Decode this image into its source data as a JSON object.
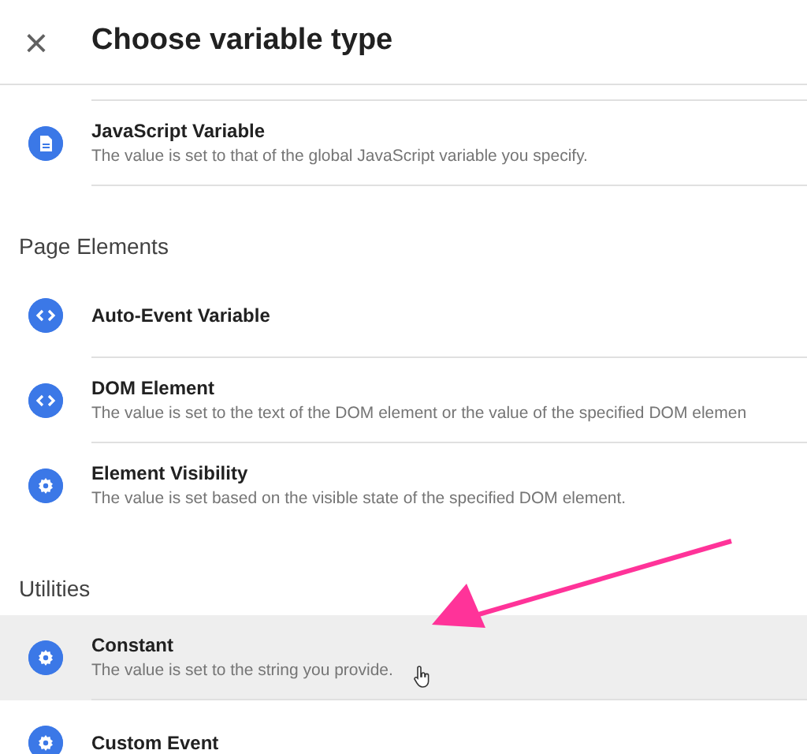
{
  "header": {
    "close": "×",
    "title": "Choose variable type"
  },
  "sections": [
    {
      "items": [
        {
          "kind": "document",
          "title": "JavaScript Variable",
          "description": "The value is set to that of the global JavaScript variable you specify.",
          "hovered": false
        }
      ]
    },
    {
      "heading": "Page Elements",
      "items": [
        {
          "kind": "code",
          "title": "Auto-Event Variable",
          "hovered": false
        },
        {
          "kind": "code",
          "title": "DOM Element",
          "description": "The value is set to the text of the DOM element or the value of the specified DOM elemen",
          "hovered": false
        },
        {
          "kind": "gear",
          "title": "Element Visibility",
          "description": "The value is set based on the visible state of the specified DOM element.",
          "hovered": false
        }
      ]
    },
    {
      "heading": "Utilities",
      "items": [
        {
          "kind": "gear",
          "title": "Constant",
          "description": "The value is set to the string you provide.",
          "hovered": true
        },
        {
          "kind": "gear",
          "title": "Custom Event",
          "hovered": false
        }
      ]
    }
  ]
}
